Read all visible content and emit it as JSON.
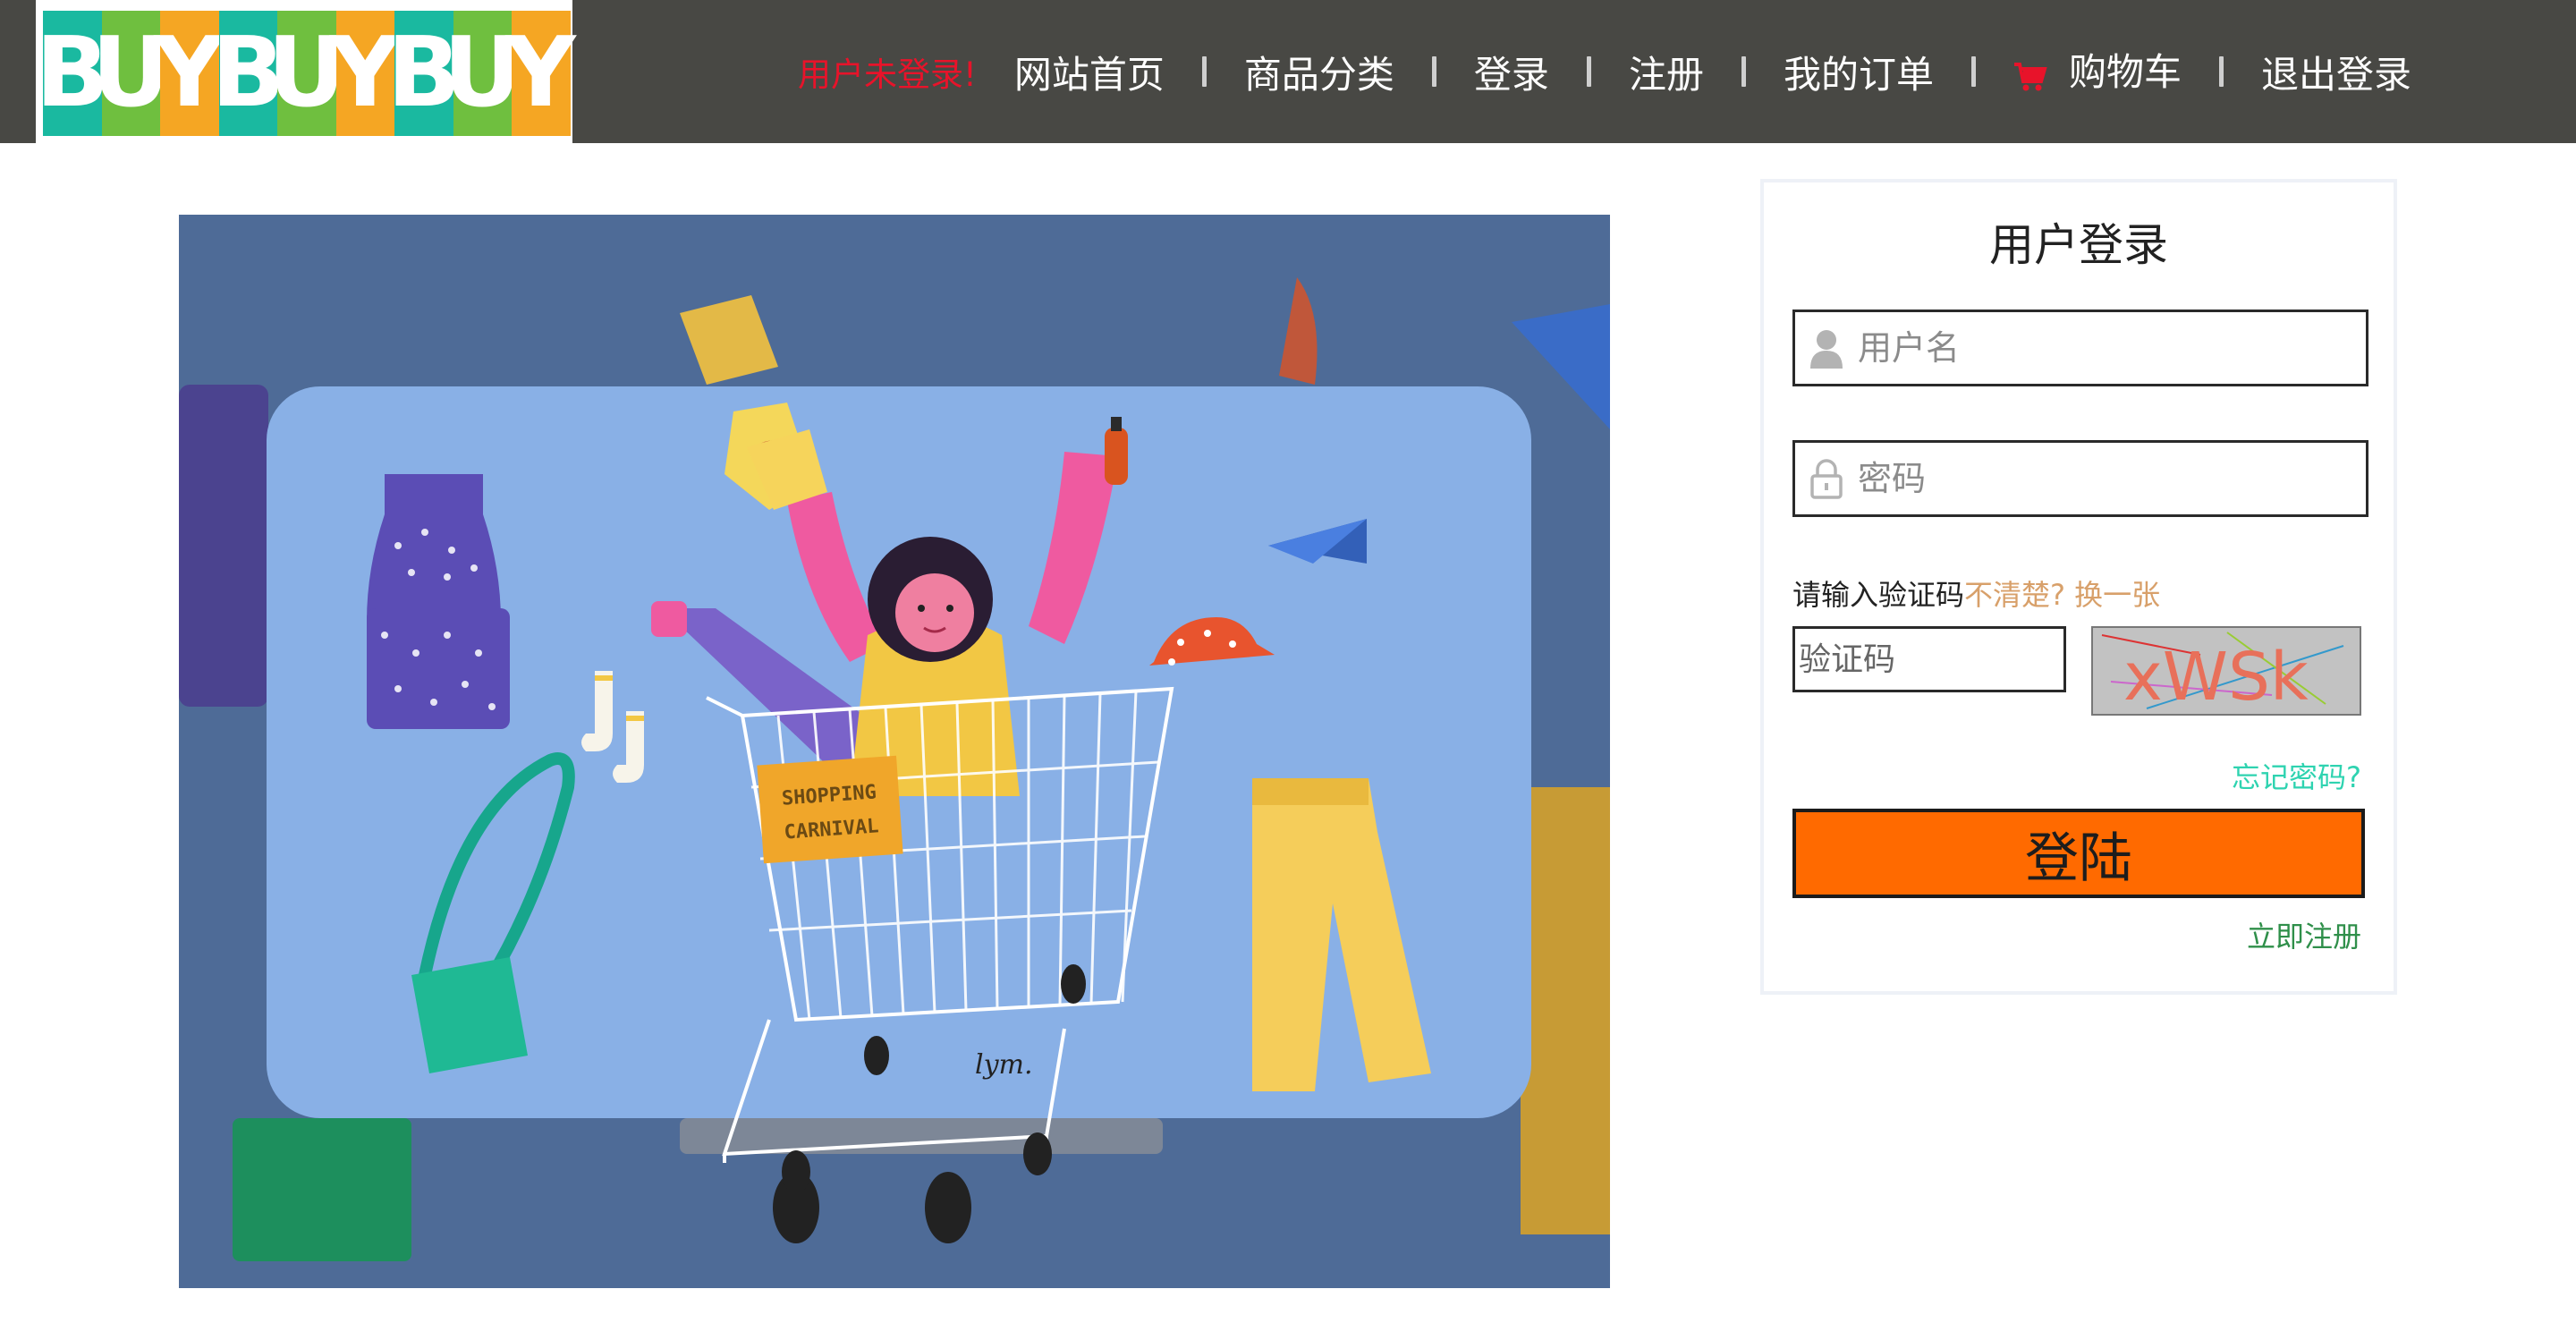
{
  "logo": {
    "letters": [
      "B",
      "U",
      "Y",
      "B",
      "U",
      "Y",
      "B",
      "U",
      "Y"
    ],
    "colors": [
      "#1ab9a0",
      "#6fbf3f",
      "#f5a623",
      "#1ab9a0",
      "#6fbf3f",
      "#f5a623",
      "#1ab9a0",
      "#6fbf3f",
      "#f5a623"
    ]
  },
  "nav": {
    "notice": "用户未登录!",
    "items": [
      "网站首页",
      "商品分类",
      "登录",
      "注册",
      "我的订单",
      "购物车",
      "退出登录"
    ]
  },
  "banner": {
    "sign_line1": "SHOPPING",
    "sign_line2": "CARNIVAL",
    "signature": "lym."
  },
  "login": {
    "title": "用户登录",
    "username_placeholder": "用户名",
    "password_placeholder": "密码",
    "captcha_tip": "请输入验证码",
    "captcha_unclear": "不清楚? 换一张",
    "captcha_placeholder": "验证码",
    "captcha_text": "xWSk",
    "forgot": "忘记密码?",
    "submit": "登陆",
    "register": "立即注册"
  },
  "colors": {
    "header_bg": "#484844",
    "button": "#ff6a00",
    "notice": "#e8132a"
  }
}
